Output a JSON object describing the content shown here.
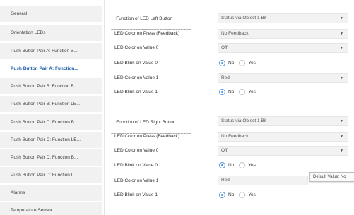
{
  "sidebar": {
    "items": [
      {
        "label": "General"
      },
      {
        "label": "Orientation LEDs"
      },
      {
        "label": "Push Button Pair A: Function B..."
      },
      {
        "label": "Push Button Pair A: Function..."
      },
      {
        "label": "Push Button Pair B: Function B..."
      },
      {
        "label": "Push Button Pair B: Function LE..."
      },
      {
        "label": "Push Button Pair C: Function B..."
      },
      {
        "label": "Push Button Pair C: Function LE..."
      },
      {
        "label": "Push Button Pair D: Function B..."
      },
      {
        "label": "Push Button Pair D: Function L..."
      },
      {
        "label": "Alarms"
      },
      {
        "label": "Temperature Sensor"
      }
    ],
    "active_index": 3
  },
  "left_section": {
    "title": "Function of LED Left Button",
    "underline": "==============================",
    "select_value": "Status via Object 1 Bit",
    "rows": {
      "press_label": "LED Color on Press (Feedback)",
      "press_value": "No Feedback",
      "color0_label": "LED Color on Value 0",
      "color0_value": "Off",
      "blink0_label": "LED Blink on Value 0",
      "color1_label": "LED Color on Value 1",
      "color1_value": "Red",
      "blink1_label": "LED Blink on Value 1"
    }
  },
  "right_section": {
    "title": "Function of LED Right Button",
    "underline": "==============================",
    "select_value": "Status via Object 1 Bit",
    "rows": {
      "press_label": "LED Color on Press (Feedback)",
      "press_value": "No Feedback",
      "color0_label": "LED Color on Value 0",
      "color0_value": "Off",
      "blink0_label": "LED Blink on Value 0",
      "color1_label": "LED Color on Value 1",
      "color1_value": "Red",
      "blink1_label": "LED Blink on Value 1"
    }
  },
  "radio": {
    "no": "No",
    "yes": "Yes"
  },
  "tooltip": {
    "text": "Default Value: No"
  },
  "caret_icon": "▼",
  "colors": {
    "active_text": "#1f5fa8",
    "radio_accent": "#4a90d9",
    "sidebar_bg": "#f1f1f1"
  }
}
